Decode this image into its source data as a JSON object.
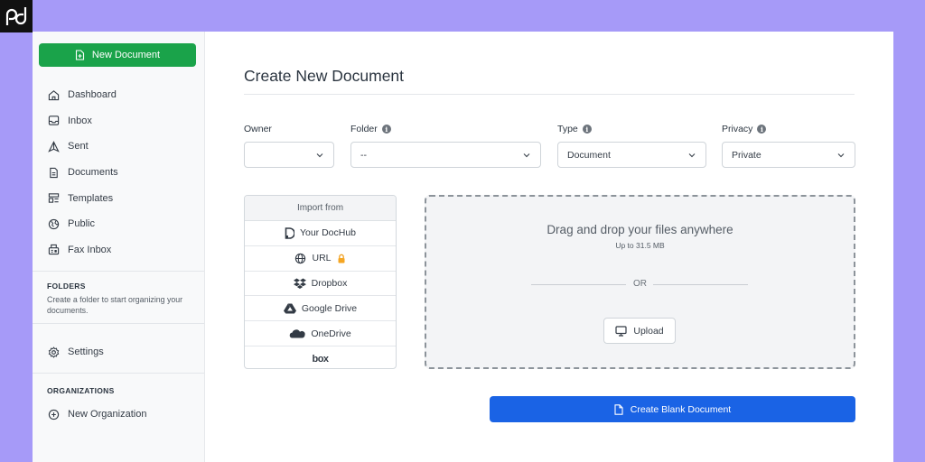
{
  "brand": {
    "logo_text": "pd",
    "accent": "#a69af8"
  },
  "sidebar": {
    "new_document_label": "New Document",
    "items": [
      {
        "label": "Dashboard",
        "icon": "home-icon"
      },
      {
        "label": "Inbox",
        "icon": "inbox-icon"
      },
      {
        "label": "Sent",
        "icon": "sent-icon"
      },
      {
        "label": "Documents",
        "icon": "document-icon"
      },
      {
        "label": "Templates",
        "icon": "templates-icon"
      },
      {
        "label": "Public",
        "icon": "globe-icon"
      },
      {
        "label": "Fax Inbox",
        "icon": "fax-icon"
      }
    ],
    "folders_title": "FOLDERS",
    "folders_text": "Create a folder to start organizing your documents.",
    "settings_label": "Settings",
    "organizations_title": "ORGANIZATIONS",
    "new_organization_label": "New Organization"
  },
  "main": {
    "title": "Create New Document",
    "fields": {
      "owner": {
        "label": "Owner",
        "value": ""
      },
      "folder": {
        "label": "Folder",
        "value": "--"
      },
      "type": {
        "label": "Type",
        "value": "Document"
      },
      "privacy": {
        "label": "Privacy",
        "value": "Private"
      }
    },
    "import": {
      "heading": "Import from",
      "sources": [
        {
          "label": "Your DocHub",
          "icon": "dochub-icon"
        },
        {
          "label": "URL",
          "icon": "globe-icon"
        },
        {
          "label": "Dropbox",
          "icon": "dropbox-icon"
        },
        {
          "label": "Google Drive",
          "icon": "google-drive-icon"
        },
        {
          "label": "OneDrive",
          "icon": "onedrive-icon"
        },
        {
          "label": "box",
          "icon": "box-logo"
        }
      ]
    },
    "dropzone": {
      "title": "Drag and drop your files anywhere",
      "limit": "Up to 31.5 MB",
      "or": "OR",
      "upload_label": "Upload"
    },
    "create_blank_label": "Create Blank Document",
    "colors": {
      "green": "#1aa34a",
      "blue": "#1a63e5"
    }
  }
}
